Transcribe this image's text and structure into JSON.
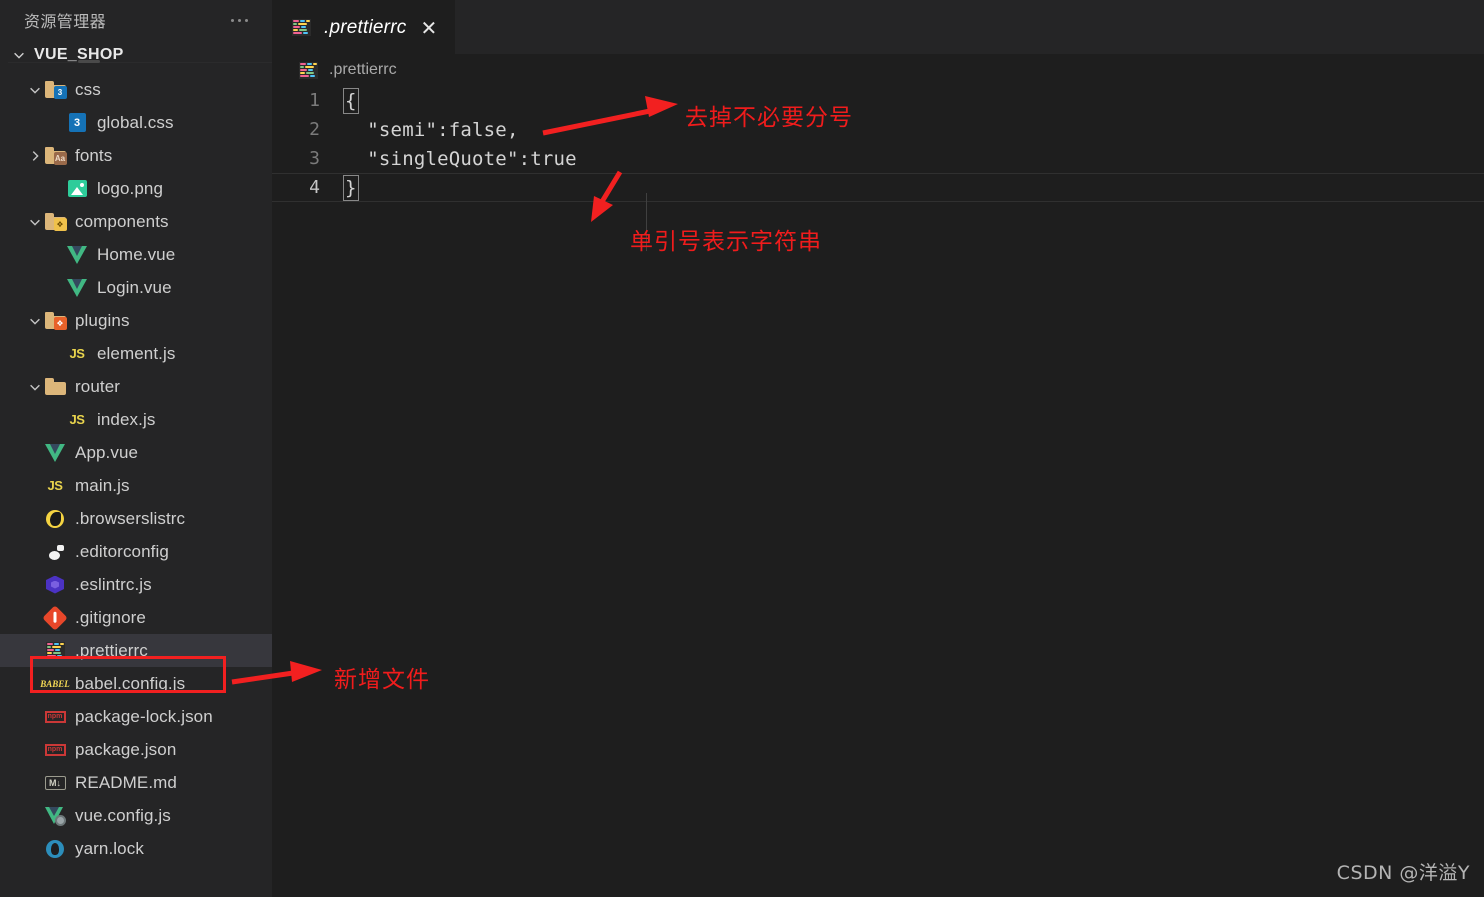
{
  "window": {
    "theme_bg": "#1e1e1e",
    "sidebar_bg": "#252526",
    "accent_red": "#f22020"
  },
  "sidebar": {
    "title": "资源管理器",
    "more_label": "...",
    "root": {
      "label": "VUE_SHOP",
      "expanded": true
    },
    "items": [
      {
        "label": "css",
        "icon": "folder-css-open-icon",
        "type": "folder",
        "depth": 1,
        "expanded": true,
        "selected": false
      },
      {
        "label": "global.css",
        "icon": "css-file-icon",
        "type": "file",
        "depth": 2,
        "selected": false
      },
      {
        "label": "fonts",
        "icon": "folder-fonts-icon",
        "type": "folder",
        "depth": 1,
        "expanded": false,
        "selected": false
      },
      {
        "label": "logo.png",
        "icon": "image-file-icon",
        "type": "file",
        "depth": 2,
        "selected": false
      },
      {
        "label": "components",
        "icon": "folder-components-icon",
        "type": "folder",
        "depth": 1,
        "expanded": true,
        "selected": false
      },
      {
        "label": "Home.vue",
        "icon": "vue-file-icon",
        "type": "file",
        "depth": 2,
        "selected": false
      },
      {
        "label": "Login.vue",
        "icon": "vue-file-icon",
        "type": "file",
        "depth": 2,
        "selected": false
      },
      {
        "label": "plugins",
        "icon": "folder-plugins-icon",
        "type": "folder",
        "depth": 1,
        "expanded": true,
        "selected": false
      },
      {
        "label": "element.js",
        "icon": "js-file-icon",
        "type": "file",
        "depth": 2,
        "selected": false
      },
      {
        "label": "router",
        "icon": "folder-icon",
        "type": "folder",
        "depth": 1,
        "expanded": true,
        "selected": false
      },
      {
        "label": "index.js",
        "icon": "js-file-icon",
        "type": "file",
        "depth": 2,
        "selected": false
      },
      {
        "label": "App.vue",
        "icon": "vue-file-icon",
        "type": "file",
        "depth": 1,
        "selected": false
      },
      {
        "label": "main.js",
        "icon": "js-file-icon",
        "type": "file",
        "depth": 1,
        "selected": false
      },
      {
        "label": ".browserslistrc",
        "icon": "browserslist-icon",
        "type": "file",
        "depth": 1,
        "selected": false
      },
      {
        "label": ".editorconfig",
        "icon": "editorconfig-icon",
        "type": "file",
        "depth": 1,
        "selected": false
      },
      {
        "label": ".eslintrc.js",
        "icon": "eslint-icon",
        "type": "file",
        "depth": 1,
        "selected": false
      },
      {
        "label": ".gitignore",
        "icon": "git-icon",
        "type": "file",
        "depth": 1,
        "selected": false
      },
      {
        "label": ".prettierrc",
        "icon": "prettier-icon",
        "type": "file",
        "depth": 1,
        "selected": true
      },
      {
        "label": "babel.config.js",
        "icon": "babel-icon",
        "type": "file",
        "depth": 1,
        "selected": false
      },
      {
        "label": "package-lock.json",
        "icon": "npm-icon",
        "type": "file",
        "depth": 1,
        "selected": false
      },
      {
        "label": "package.json",
        "icon": "npm-icon",
        "type": "file",
        "depth": 1,
        "selected": false
      },
      {
        "label": "README.md",
        "icon": "markdown-icon",
        "type": "file",
        "depth": 1,
        "selected": false
      },
      {
        "label": "vue.config.js",
        "icon": "vue-config-icon",
        "type": "file",
        "depth": 1,
        "selected": false
      },
      {
        "label": "yarn.lock",
        "icon": "yarn-icon",
        "type": "file",
        "depth": 1,
        "selected": false
      }
    ]
  },
  "editor": {
    "tab": {
      "label": ".prettierrc",
      "icon": "prettier-icon",
      "close_label": "✕",
      "preview_italic": true
    },
    "breadcrumb": {
      "label": ".prettierrc",
      "icon": "prettier-icon"
    },
    "lines": [
      {
        "num": "1",
        "text": "{",
        "active": false
      },
      {
        "num": "2",
        "text": "  \"semi\":false,",
        "active": false
      },
      {
        "num": "3",
        "text": "  \"singleQuote\":true",
        "active": false
      },
      {
        "num": "4",
        "text": "}",
        "active": true
      }
    ]
  },
  "annotations": {
    "note_semicolon": "去掉不必要分号",
    "note_singlequote": "单引号表示字符串",
    "note_newfile": "新增文件"
  },
  "watermark": {
    "text": "CSDN @洋溢Y"
  }
}
